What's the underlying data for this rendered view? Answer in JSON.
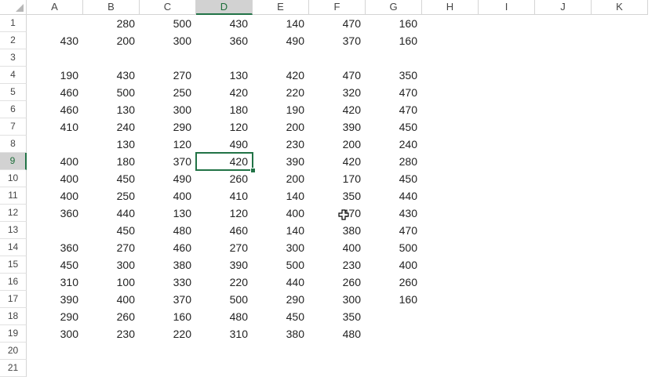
{
  "columns": [
    "A",
    "B",
    "C",
    "D",
    "E",
    "F",
    "G",
    "H",
    "I",
    "J",
    "K"
  ],
  "rows": [
    "1",
    "2",
    "3",
    "4",
    "5",
    "6",
    "7",
    "8",
    "9",
    "10",
    "11",
    "12",
    "13",
    "14",
    "15",
    "16",
    "17",
    "18",
    "19",
    "20",
    "21"
  ],
  "active_cell": {
    "col": "D",
    "row": "9"
  },
  "cells": [
    [
      "",
      "280",
      "500",
      "430",
      "140",
      "470",
      "160"
    ],
    [
      "430",
      "200",
      "300",
      "360",
      "490",
      "370",
      "160"
    ],
    [
      "",
      "",
      "",
      "",
      "",
      "",
      ""
    ],
    [
      "190",
      "430",
      "270",
      "130",
      "420",
      "470",
      "350"
    ],
    [
      "460",
      "500",
      "250",
      "420",
      "220",
      "320",
      "470"
    ],
    [
      "460",
      "130",
      "300",
      "180",
      "190",
      "420",
      "470"
    ],
    [
      "410",
      "240",
      "290",
      "120",
      "200",
      "390",
      "450"
    ],
    [
      "",
      "130",
      "120",
      "490",
      "230",
      "200",
      "240"
    ],
    [
      "400",
      "180",
      "370",
      "420",
      "390",
      "420",
      "280"
    ],
    [
      "400",
      "450",
      "490",
      "260",
      "200",
      "170",
      "450"
    ],
    [
      "400",
      "250",
      "400",
      "410",
      "140",
      "350",
      "440"
    ],
    [
      "360",
      "440",
      "130",
      "120",
      "400",
      "470",
      "430"
    ],
    [
      "",
      "450",
      "480",
      "460",
      "140",
      "380",
      "470"
    ],
    [
      "360",
      "270",
      "460",
      "270",
      "300",
      "400",
      "500"
    ],
    [
      "450",
      "300",
      "380",
      "390",
      "500",
      "230",
      "400"
    ],
    [
      "310",
      "100",
      "330",
      "220",
      "440",
      "260",
      "260"
    ],
    [
      "390",
      "400",
      "370",
      "500",
      "290",
      "300",
      "160"
    ],
    [
      "290",
      "260",
      "160",
      "480",
      "450",
      "350",
      ""
    ],
    [
      "300",
      "230",
      "220",
      "310",
      "380",
      "480",
      ""
    ],
    [
      "",
      "",
      "",
      "",
      "",
      "",
      ""
    ],
    [
      "",
      "",
      "",
      "",
      "",
      "",
      ""
    ]
  ],
  "colors": {
    "accent": "#217346",
    "grid": "#e1e1e1",
    "header_selected": "#d2d2d2"
  },
  "icons": {
    "cursor": "plus-cursor-icon"
  }
}
